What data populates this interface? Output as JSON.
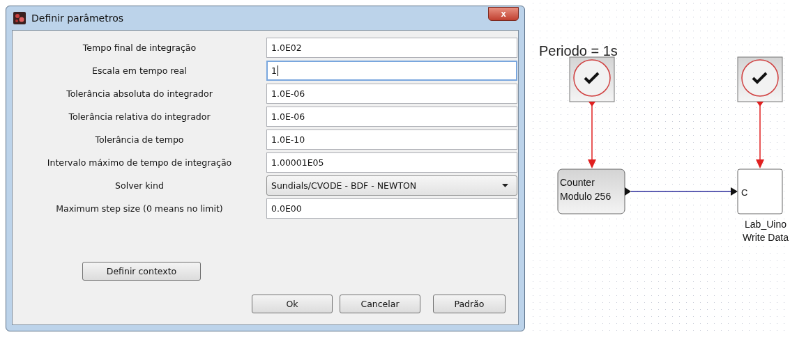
{
  "dialog": {
    "title": "Definir parâmetros",
    "close_label": "x",
    "fields": [
      {
        "label": "Tempo final de integração",
        "kind": "text",
        "value": "1.0E02",
        "focused": false
      },
      {
        "label": "Escala em tempo real",
        "kind": "text",
        "value": "1",
        "focused": true
      },
      {
        "label": "Tolerância absoluta do integrador",
        "kind": "text",
        "value": "1.0E-06",
        "focused": false
      },
      {
        "label": "Tolerância relativa do integrador",
        "kind": "text",
        "value": "1.0E-06",
        "focused": false
      },
      {
        "label": "Tolerância de tempo",
        "kind": "text",
        "value": "1.0E-10",
        "focused": false
      },
      {
        "label": "Intervalo máximo de tempo de integração",
        "kind": "text",
        "value": "1.00001E05",
        "focused": false
      },
      {
        "label": "Solver kind",
        "kind": "dropdown",
        "value": "Sundials/CVODE - BDF - NEWTON"
      },
      {
        "label": "Maximum step size (0 means no limit)",
        "kind": "text",
        "value": "0.0E00",
        "focused": false
      }
    ],
    "context_button": "Definir contexto",
    "buttons": [
      "Ok",
      "Cancelar",
      "Padrão"
    ]
  },
  "diagram": {
    "annotation": "Periodo = 1s",
    "blocks": [
      {
        "kind": "clock"
      },
      {
        "kind": "clock"
      },
      {
        "kind": "counter",
        "lines": [
          "Counter",
          "Modulo 256"
        ]
      },
      {
        "kind": "write",
        "port_label": "C",
        "caption": [
          "Lab_Uino",
          "Write Data"
        ]
      }
    ]
  }
}
